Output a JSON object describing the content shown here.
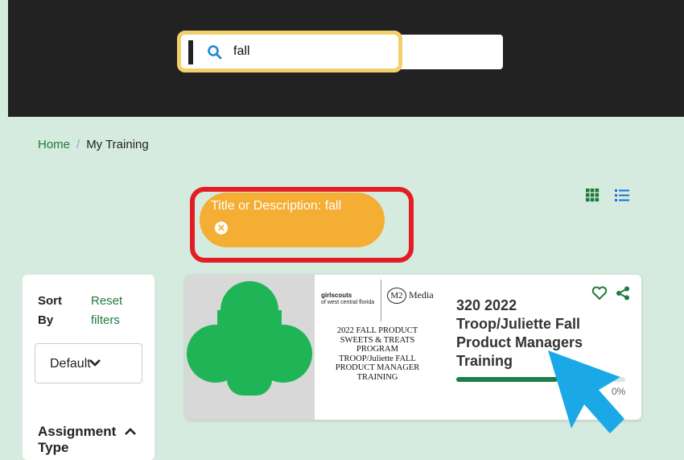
{
  "search": {
    "value": "fall"
  },
  "breadcrumb": {
    "home": "Home",
    "separator": "/",
    "current": "My Training"
  },
  "view_toggle": {
    "grid_icon": "grid-icon",
    "list_icon": "list-icon",
    "active_color": "#1f7a3a"
  },
  "filter_chip": {
    "label": "Title or Description: fall",
    "close_icon": "close-circle-icon",
    "chip_color": "#f5ae34",
    "highlight_color": "#e51c23"
  },
  "sidebar": {
    "sort_label": "Sort By",
    "reset_label": "Reset filters",
    "sort_select": {
      "value": "Default"
    },
    "assignment_type_label": "Assignment Type"
  },
  "course_card": {
    "title": "320 2022 Troop/Juliette Fall Product Managers Training",
    "promo": {
      "logo_org": "girlscouts",
      "logo_sub": "of west central florida",
      "media_mark": "M2",
      "media_word": "Media",
      "lines": [
        "2022 FALL PRODUCT",
        "SWEETS & TREATS",
        "PROGRAM",
        "TROOP/Juliette FALL",
        "PRODUCT MANAGER",
        "TRAINING"
      ]
    },
    "progress_text": "0%",
    "progress_fraction": 0.6,
    "favorite_icon": "heart-icon",
    "share_icon": "share-icon"
  },
  "colors": {
    "header_bg": "#222222",
    "page_bg": "#d5ebdf",
    "search_highlight": "#f2d16b",
    "brand_green": "#1f7a3a",
    "trefoil_green": "#1fb556",
    "cursor_blue": "#1aa9e6"
  }
}
